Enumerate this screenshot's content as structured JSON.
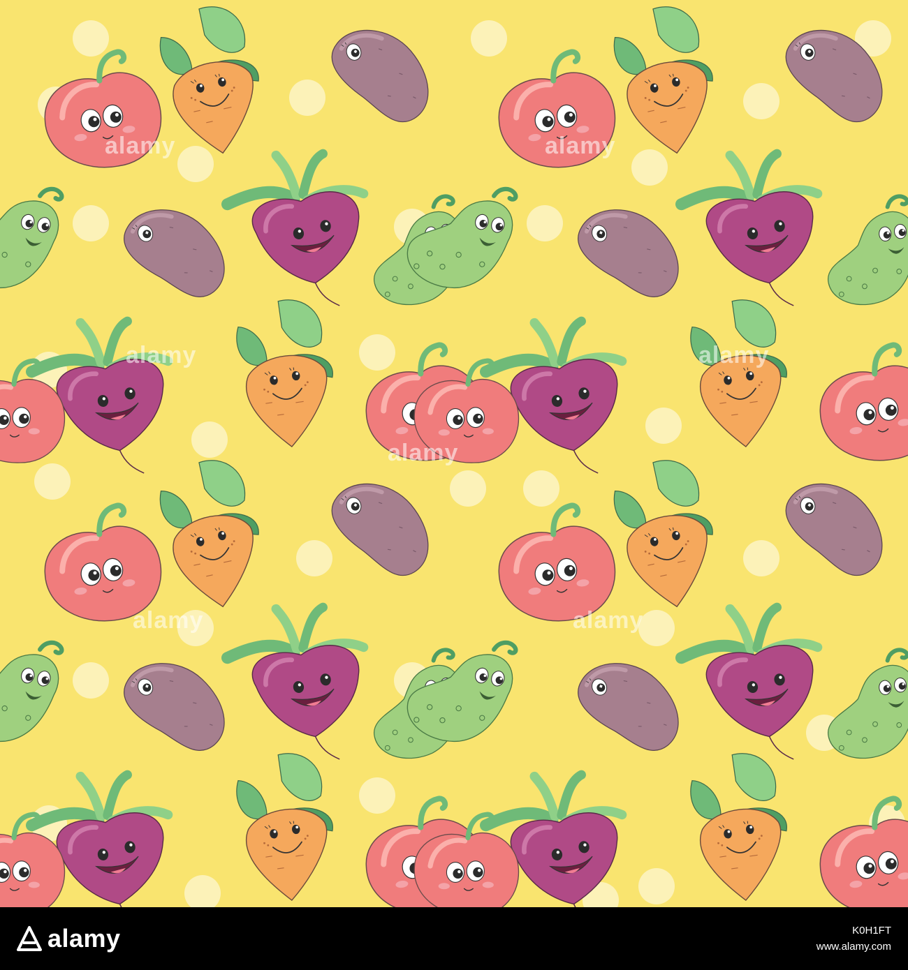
{
  "artwork": {
    "background_color": "#f9e46f",
    "dot_color": "#fcf2b8",
    "characters": [
      "tomato",
      "carrot",
      "potato",
      "beet",
      "cucumber"
    ],
    "colors": {
      "tomato": "#f07c7c",
      "carrot": "#f5a85c",
      "potato": "#a67f8e",
      "beet": "#b04a86",
      "cucumber": "#9fd07f",
      "leaf": "#6fba78",
      "leaf_dark": "#4f9e63"
    },
    "watermark_text": "alamy"
  },
  "footer": {
    "logo_text": "alamy",
    "image_id": "K0H1FT",
    "site": "www.alamy.com"
  }
}
